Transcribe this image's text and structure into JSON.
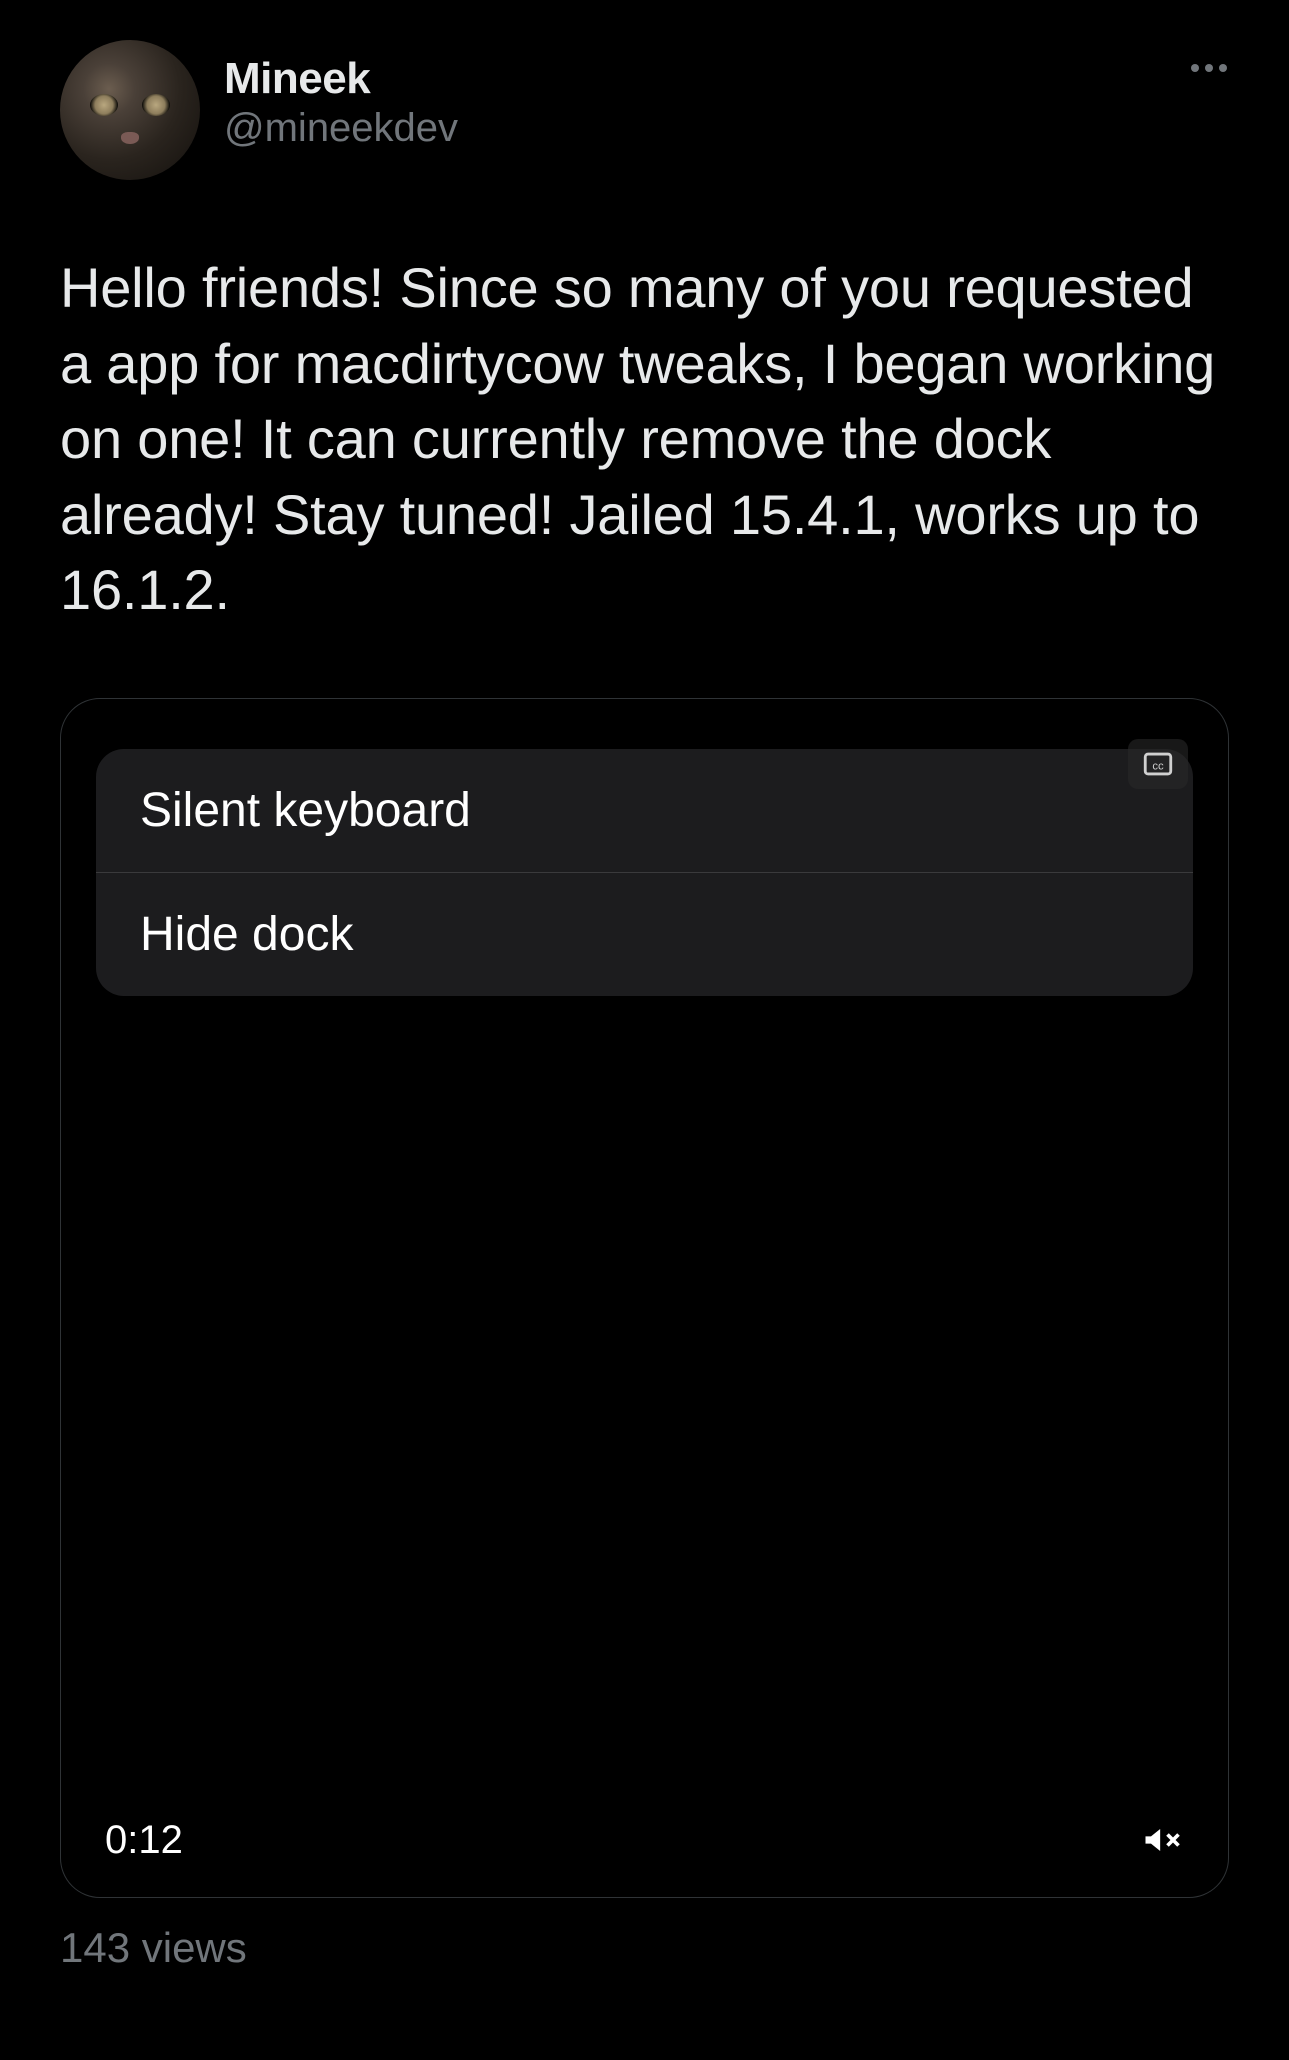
{
  "author": {
    "display_name": "Mineek",
    "handle": "@mineekdev"
  },
  "tweet_text": "Hello friends! Since so many of you requested a app for macdirtycow tweaks, I began working on one! It can currently remove the dock already! Stay tuned! Jailed 15.4.1, works up to 16.1.2.",
  "media": {
    "ios_rows": [
      "Silent keyboard",
      "Hide dock"
    ],
    "timestamp": "0:12",
    "cc_label": "cc"
  },
  "views_text": "143 views"
}
